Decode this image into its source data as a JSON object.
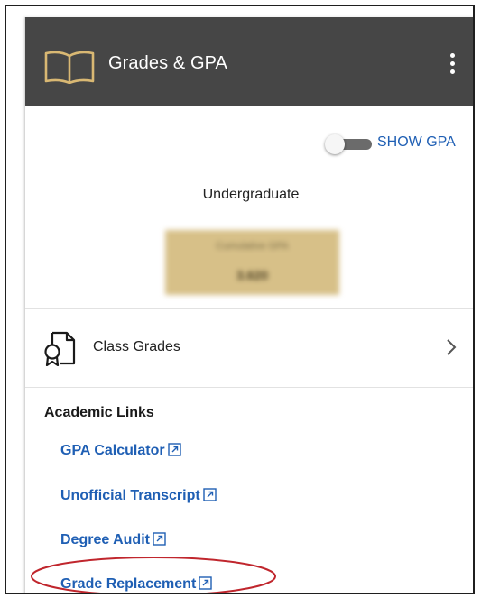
{
  "header": {
    "title": "Grades & GPA",
    "icon": "book-icon",
    "menu_icon": "kebab-menu-icon",
    "background_color": "#464646"
  },
  "gpa": {
    "toggle_label": "SHOW GPA",
    "toggle_on": false,
    "level": "Undergraduate",
    "box_label": "Cumulative GPA",
    "box_value": "3.620",
    "box_obscured": true,
    "box_color": "#d7c088"
  },
  "class_grades": {
    "label": "Class Grades",
    "icon": "certificate-icon",
    "chevron_icon": "chevron-right-icon"
  },
  "academic_links": {
    "title": "Academic Links",
    "link_color": "#1f5fb4",
    "external_icon": "external-link-icon",
    "items": [
      {
        "label": "GPA Calculator"
      },
      {
        "label": "Unofficial Transcript"
      },
      {
        "label": "Degree Audit"
      },
      {
        "label": "Grade Replacement",
        "highlighted": true
      }
    ]
  },
  "highlight_color": "#c0262d"
}
